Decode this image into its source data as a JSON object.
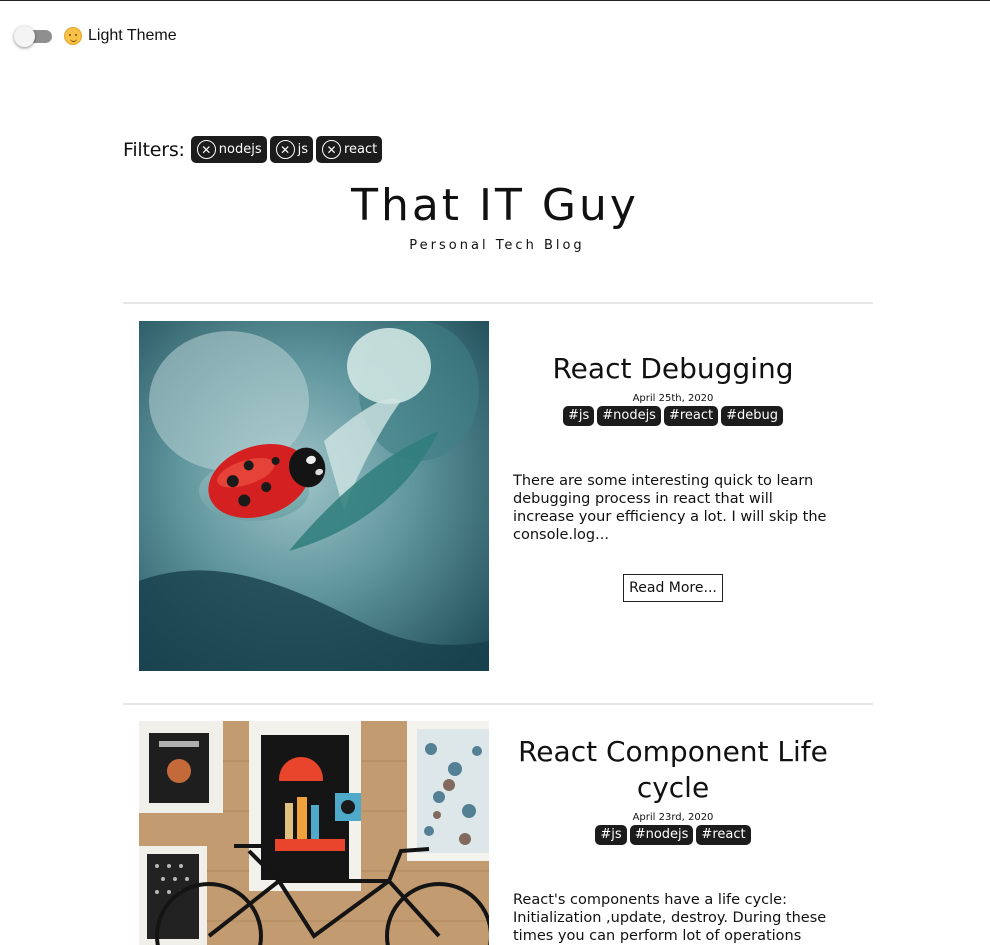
{
  "theme_toggle": {
    "label": "Light Theme",
    "icon": "smiley-emoji-icon",
    "checked": false
  },
  "filters": {
    "label": "Filters:",
    "chips": [
      {
        "label": "nodejs"
      },
      {
        "label": "js"
      },
      {
        "label": "react"
      }
    ]
  },
  "site": {
    "title": "That IT Guy",
    "subtitle": "Personal Tech Blog"
  },
  "posts": [
    {
      "title": "React Debugging",
      "date": "April 25th, 2020",
      "tags": [
        "#js",
        "#nodejs",
        "#react",
        "#debug"
      ],
      "excerpt": "There are some interesting quick to learn debugging process in react that will increase your efficiency a lot. I will skip the console.log...",
      "read_more": "Read More...",
      "image": "ladybug-on-leaf-photo"
    },
    {
      "title": "React Component Life cycle",
      "date": "April 23rd, 2020",
      "tags": [
        "#js",
        "#nodejs",
        "#react"
      ],
      "excerpt": "React's components have a life cycle: Initialization ,update, destroy. During these times you can perform lot of operations that",
      "image": "bicycle-and-posters-photo"
    }
  ],
  "colors": {
    "chip_bg": "#1c1c1c",
    "divider": "#e6e6e6",
    "toggle_track": "#8f8f8f"
  }
}
